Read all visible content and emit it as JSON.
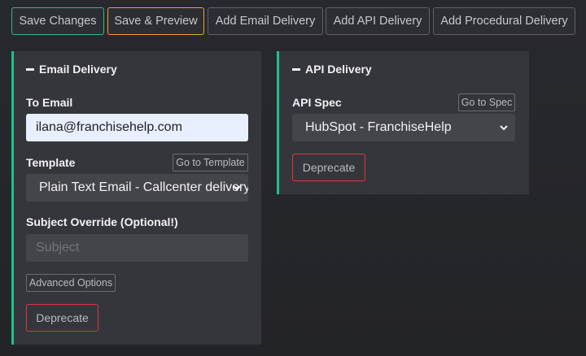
{
  "toolbar": {
    "save_changes": "Save Changes",
    "save_preview": "Save & Preview",
    "add_email": "Add Email Delivery",
    "add_api": "Add API Delivery",
    "add_procedural": "Add Procedural Delivery"
  },
  "email_delivery": {
    "title": "Email Delivery",
    "to_email_label": "To Email",
    "to_email_value": "ilana@franchisehelp.com",
    "template_label": "Template",
    "go_to_template": "Go to Template",
    "template_selected": "Plain Text Email - Callcenter delivery",
    "subject_label": "Subject Override (Optional!)",
    "subject_placeholder": "Subject",
    "advanced_options": "Advanced Options",
    "deprecate": "Deprecate"
  },
  "api_delivery": {
    "title": "API Delivery",
    "api_spec_label": "API Spec",
    "go_to_spec": "Go to Spec",
    "api_spec_selected": "HubSpot - FranchiseHelp",
    "deprecate": "Deprecate"
  },
  "colors": {
    "accent_green": "#23c08a",
    "accent_orange": "#e4a52c",
    "danger_red": "#d9383e"
  }
}
